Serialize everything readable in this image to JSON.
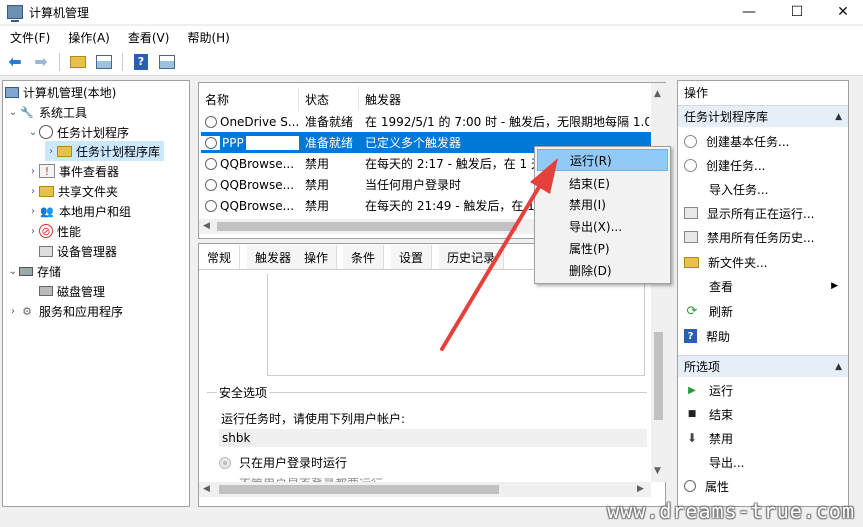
{
  "window": {
    "title": "计算机管理",
    "minimize": "—",
    "maximize": "☐",
    "close": "✕"
  },
  "menu": [
    "文件(F)",
    "操作(A)",
    "查看(V)",
    "帮助(H)"
  ],
  "toolbar": {
    "icons": [
      "back-arrow-icon",
      "forward-arrow-icon",
      "up-folder-icon",
      "show-hide-tree-icon",
      "help-icon",
      "show-hide-action-pane-icon"
    ]
  },
  "tree": {
    "root": "计算机管理(本地)",
    "system_tools": "系统工具",
    "task_scheduler": "任务计划程序",
    "task_scheduler_library": "任务计划程序库",
    "event_viewer": "事件查看器",
    "shared_folders": "共享文件夹",
    "local_users_groups": "本地用户和组",
    "performance": "性能",
    "device_manager": "设备管理器",
    "storage": "存储",
    "disk_management": "磁盘管理",
    "services_apps": "服务和应用程序"
  },
  "task_list": {
    "columns": [
      "名称",
      "状态",
      "触发器"
    ],
    "rows": [
      {
        "name": "OneDrive S...",
        "status": "准备就绪",
        "trigger": "在 1992/5/1 的 7:00 时 - 触发后，无限期地每隔 1.0"
      },
      {
        "name": "PPP",
        "status": "准备就绪",
        "trigger": "已定义多个触发器"
      },
      {
        "name": "QQBrowse...",
        "status": "禁用",
        "trigger": "在每天的 2:17 - 触发后，在 1 天"
      },
      {
        "name": "QQBrowse...",
        "status": "禁用",
        "trigger": "当任何用户登录时"
      },
      {
        "name": "QQBrowse...",
        "status": "禁用",
        "trigger": "在每天的 21:49 - 触发后，在 1"
      }
    ]
  },
  "context_menu": {
    "items": [
      "运行(R)",
      "结束(E)",
      "禁用(I)",
      "导出(X)...",
      "属性(P)",
      "删除(D)"
    ]
  },
  "details": {
    "tabs": [
      "常规",
      "触发器",
      "操作",
      "条件",
      "设置",
      "历史记录"
    ],
    "security_title": "安全选项",
    "run_as_label": "运行任务时，请使用下列用户帐户:",
    "user_account": "shbk",
    "radio_logged_on": "只在用户登录时运行",
    "radio_whether": "不管用户是否登录都要运行"
  },
  "actions": {
    "title": "操作",
    "section1": "任务计划程序库",
    "section1_items": [
      "创建基本任务...",
      "创建任务...",
      "导入任务...",
      "显示所有正在运行...",
      "禁用所有任务历史...",
      "新文件夹...",
      "查看",
      "刷新",
      "帮助"
    ],
    "section2": "所选项",
    "section2_items": [
      "运行",
      "结束",
      "禁用",
      "导出...",
      "属性"
    ]
  },
  "watermark": "www.dreams-true.com",
  "colors": {
    "selection": "#0078d7",
    "menu_hover": "#91c9f7",
    "arrow": "#e5413c"
  }
}
